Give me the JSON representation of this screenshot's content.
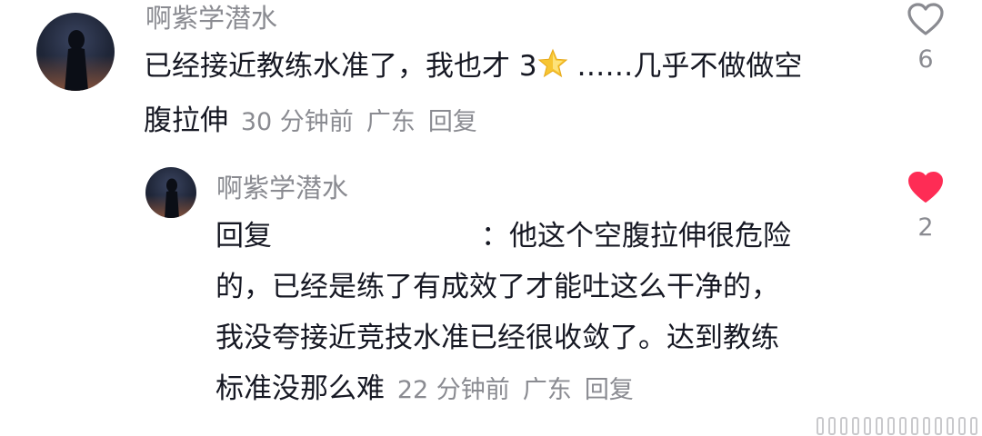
{
  "comments": [
    {
      "author": "啊紫学潜水",
      "text_line1": "已经接近教练水准了，我也才 3",
      "text_after_icon": " ……几乎不做做空",
      "text_line2": "腹拉伸",
      "time": "30 分钟前",
      "location": "广东",
      "reply_label": "回复",
      "like_count": "6",
      "liked": false,
      "icon": "star-emoji-icon"
    },
    {
      "author": "啊紫学潜水",
      "reply_prefix": "回复",
      "text_line1_rest": "：他这个空腹拉伸很危险",
      "text_line2": "的，已经是练了有成效了才能吐这么干净的，",
      "text_line3": "我没夸接近竞技水准已经很收敛了。达到教练",
      "text_line4": "标准没那么难",
      "time": "22 分钟前",
      "location": "广东",
      "reply_label": "回复",
      "like_count": "2",
      "liked": true
    }
  ],
  "colors": {
    "text": "#161823",
    "meta": "#8a8b91",
    "heart_liked": "#fe2c55",
    "heart_outline": "#8a8b91"
  }
}
